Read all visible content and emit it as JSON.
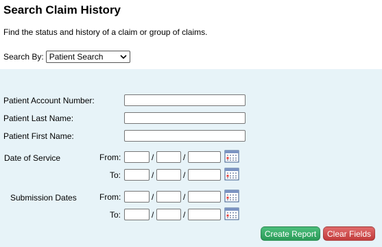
{
  "page": {
    "title": "Search Claim History",
    "description": "Find the status and history of a claim or group of claims."
  },
  "search_by": {
    "label": "Search By:",
    "selected": "Patient Search"
  },
  "fields": {
    "account_number": {
      "label": "Patient Account Number:",
      "value": ""
    },
    "last_name": {
      "label": "Patient Last Name:",
      "value": ""
    },
    "first_name": {
      "label": "Patient First Name:",
      "value": ""
    }
  },
  "date_of_service": {
    "label": "Date of Service",
    "from_label": "From:",
    "to_label": "To:"
  },
  "submission_dates": {
    "label": "Submission Dates",
    "from_label": "From:",
    "to_label": "To:"
  },
  "date_separator": "/",
  "buttons": {
    "create_report": "Create Report",
    "clear_fields": "Clear Fields"
  },
  "colors": {
    "panel_bg": "#e7f3f8",
    "green_button": "#2fa35f",
    "red_button": "#cc4646"
  },
  "icons": {
    "calendar": "calendar-icon",
    "dropdown": "chevron-down-icon"
  }
}
